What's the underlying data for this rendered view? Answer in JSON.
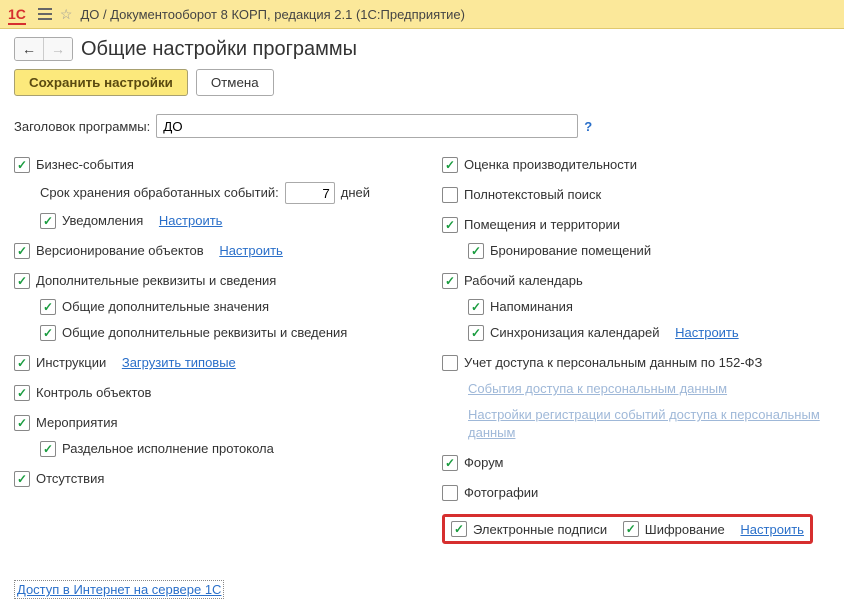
{
  "titlebar": {
    "app_title": "ДО / Документооборот 8 КОРП, редакция 2.1  (1С:Предприятие)"
  },
  "header": {
    "page_title": "Общие настройки программы",
    "save_button": "Сохранить настройки",
    "cancel_button": "Отмена"
  },
  "main_field": {
    "label": "Заголовок программы:",
    "value": "ДО",
    "help": "?"
  },
  "left": {
    "business_events": "Бизнес-события",
    "retention_label": "Срок хранения обработанных событий:",
    "retention_value": "7",
    "retention_unit": "дней",
    "notifications": "Уведомления",
    "configure": "Настроить",
    "versioning": "Версионирование объектов",
    "additional_props": "Дополнительные реквизиты и сведения",
    "common_values": "Общие дополнительные значения",
    "common_props": "Общие дополнительные реквизиты и сведения",
    "instructions": "Инструкции",
    "load_typical": "Загрузить типовые",
    "object_control": "Контроль объектов",
    "events": "Мероприятия",
    "split_protocol": "Раздельное исполнение протокола",
    "absence": "Отсутствия"
  },
  "right": {
    "performance": "Оценка производительности",
    "fulltext": "Полнотекстовый поиск",
    "rooms": "Помещения и территории",
    "booking": "Бронирование помещений",
    "calendar": "Рабочий календарь",
    "reminders": "Напоминания",
    "sync": "Синхронизация календарей",
    "configure": "Настроить",
    "pd_access": "Учет доступа к персональным данным по 152-ФЗ",
    "pd_events": "События доступа к персональным данным",
    "pd_settings": "Настройки регистрации событий доступа к персональным данным",
    "forum": "Форум",
    "photos": "Фотографии",
    "esign": "Электронные подписи",
    "encryption": "Шифрование"
  },
  "footer": {
    "internet_access": "Доступ в Интернет на сервере 1С"
  }
}
